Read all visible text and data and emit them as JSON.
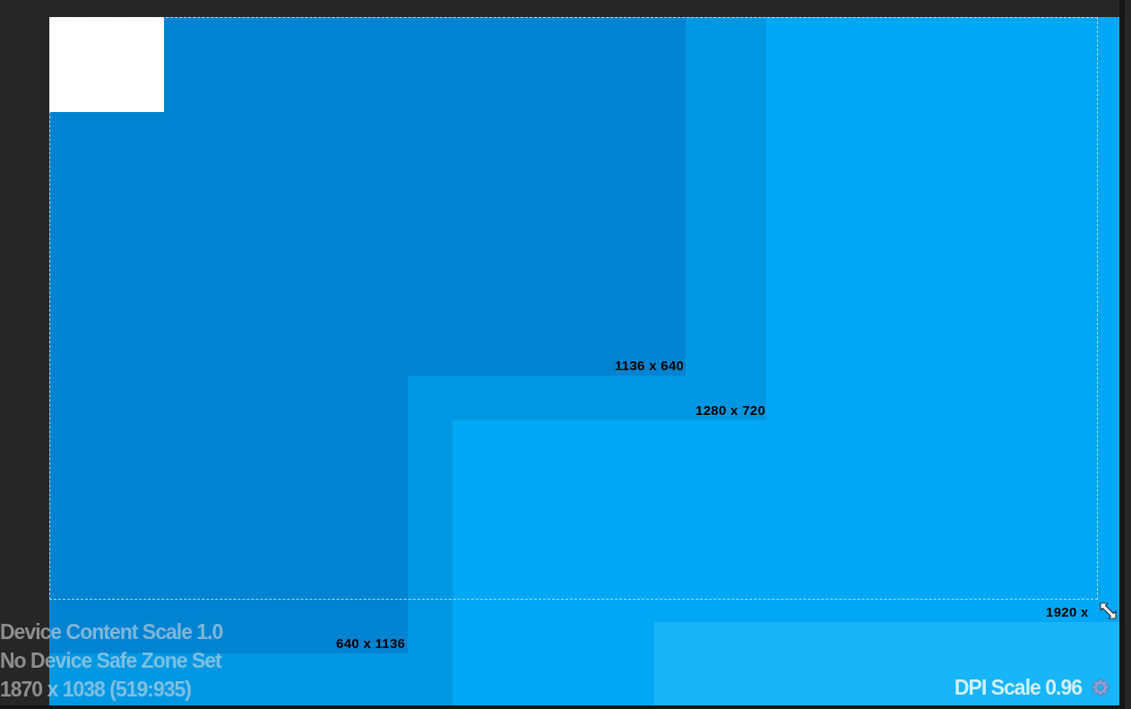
{
  "viewport": {
    "frames": [
      {
        "label": "1920 x",
        "color": "#00a7f5"
      },
      {
        "color": "#00a7f5"
      },
      {
        "label": "1280 x 720",
        "color": "#0097e2"
      },
      {
        "color": "#0097e2"
      },
      {
        "label": "1136 x 640",
        "color": "#0083d1"
      },
      {
        "label": "640 x 1136",
        "color": "#0083d1"
      }
    ],
    "info_lines": [
      "Device Content Scale 1.0",
      "No Device Safe Zone Set",
      "1870 x 1038 (519:935)"
    ],
    "dpi_scale": "DPI Scale 0.96"
  }
}
